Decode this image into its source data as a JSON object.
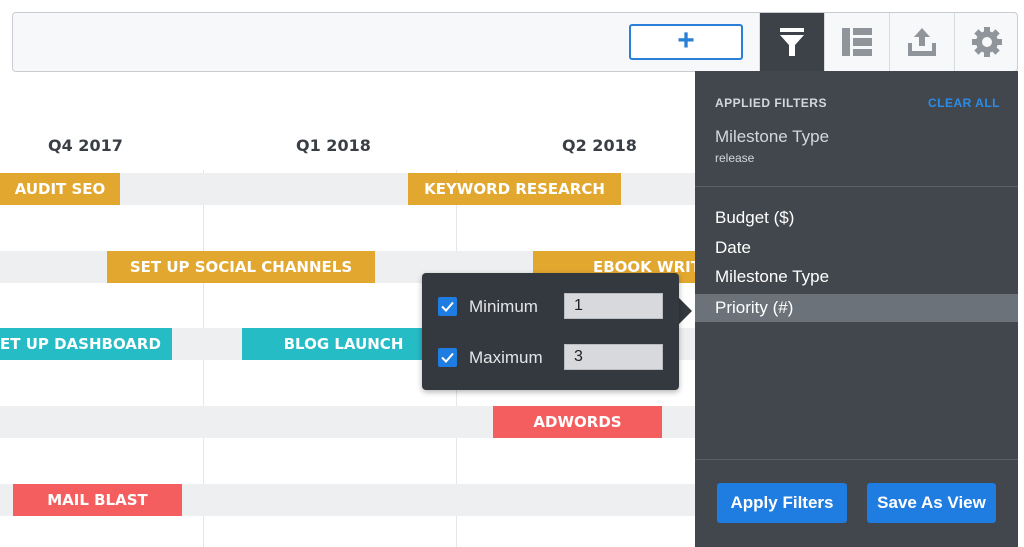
{
  "toolbar": {
    "add_label": "+",
    "tools": [
      "filter-icon",
      "layout-icon",
      "export-icon",
      "settings-icon"
    ]
  },
  "timeline": {
    "quarters": [
      "Q4 2017",
      "Q1 2018",
      "Q2 2018"
    ],
    "milestones": [
      {
        "label": "AUDIT SEO",
        "color": "#e2a72e"
      },
      {
        "label": "KEYWORD RESEARCH",
        "color": "#e2a72e"
      },
      {
        "label": "SET UP SOCIAL CHANNELS",
        "color": "#e2a72e"
      },
      {
        "label": "EBOOK WRITING",
        "color": "#e2a72e"
      },
      {
        "label": "ET UP DASHBOARD",
        "color": "#26bcc6"
      },
      {
        "label": "BLOG LAUNCH",
        "color": "#26bcc6"
      },
      {
        "label": "ADWORDS",
        "color": "#f45e5e"
      },
      {
        "label": "MAIL BLAST",
        "color": "#f45e5e"
      }
    ]
  },
  "filters": {
    "heading": "APPLIED FILTERS",
    "clear_all": "CLEAR ALL",
    "applied": {
      "name": "Milestone Type",
      "value": "release"
    },
    "options": [
      "Budget ($)",
      "Date",
      "Milestone Type",
      "Priority (#)"
    ],
    "selected_option": "Priority (#)",
    "apply_label": "Apply Filters",
    "save_label": "Save As View"
  },
  "range_popover": {
    "min_label": "Minimum",
    "min_value": "1",
    "min_checked": true,
    "max_label": "Maximum",
    "max_value": "3",
    "max_checked": true
  },
  "colors": {
    "accent": "#1f7ce0",
    "panel": "#42474d",
    "gold": "#e2a72e",
    "teal": "#26bcc6",
    "red": "#f45e5e"
  }
}
